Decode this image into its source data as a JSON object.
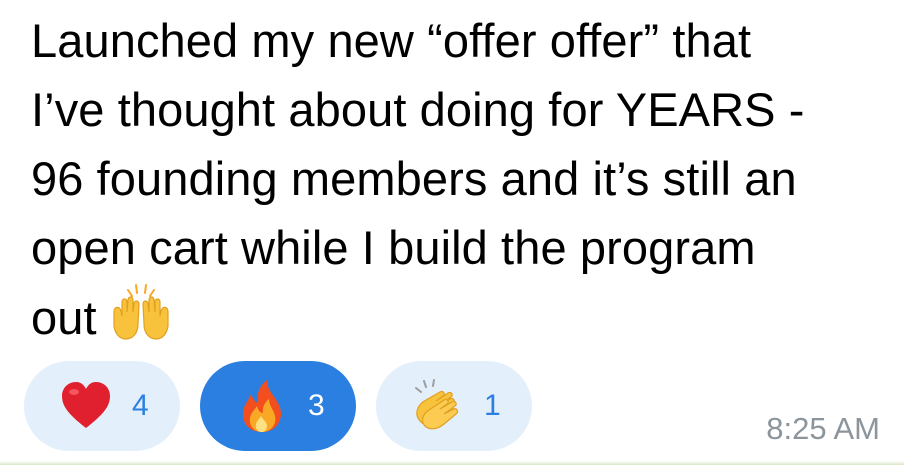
{
  "message": {
    "lines": [
      "Launched my new “offer offer” that",
      "I’ve thought about doing for YEARS -",
      "96 founding members and it’s still an",
      "open cart while I build the program",
      "out"
    ],
    "trailing_emoji": "raising-hands-icon",
    "timestamp": "8:25 AM"
  },
  "reactions": [
    {
      "icon": "heart-icon",
      "count": "4",
      "active": false
    },
    {
      "icon": "fire-icon",
      "count": "3",
      "active": true
    },
    {
      "icon": "clapping-hands-icon",
      "count": "1",
      "active": false
    }
  ],
  "colors": {
    "accent": "#2a7fe0",
    "reaction_bg": "#e3effb",
    "timestamp": "#8c959c",
    "heart": "#e0202e",
    "fire": "#f28c1c",
    "hands": "#f9c23c"
  }
}
